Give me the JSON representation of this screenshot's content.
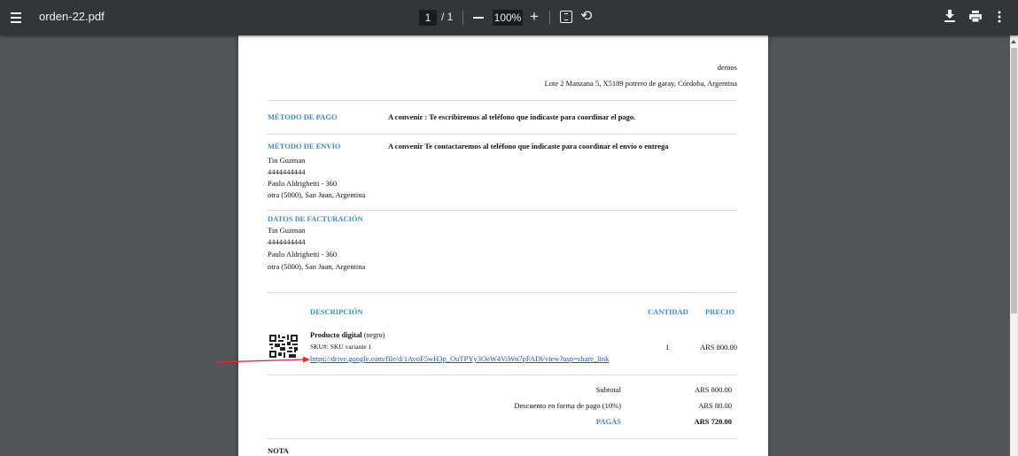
{
  "toolbar": {
    "file_name": "orden-22.pdf",
    "current_page": "1",
    "page_total": "/ 1",
    "zoom": "100%",
    "zoom_in_symbol": "+",
    "rotate_symbol": "⟲"
  },
  "icons": {
    "menu": "hamburger-menu-icon",
    "zoom_out": "minus-icon",
    "zoom_in": "plus-icon",
    "fit": "fit-page-icon",
    "rotate": "rotate-icon",
    "download": "download-icon",
    "print": "print-icon",
    "more": "more-vertical-icon"
  },
  "colors": {
    "toolbar_bg": "#323639",
    "viewer_bg": "#525659",
    "accent_blue": "#3a8ad4",
    "link": "#1a56c8",
    "arrow": "#e8262a"
  },
  "document": {
    "store_name": "demos",
    "store_address": "Lote 2 Manzana 5, X5189 potrero de garay, Córdoba, Argentina",
    "payment": {
      "label": "MÉTODO DE PAGO",
      "value": "A convenir : Te escribiremos al teléfono que indicaste para coordinar el pago."
    },
    "shipping": {
      "label": "MÉTODO DE ENVÍO",
      "value": "A convenir Te contactaremos al teléfono que indicaste para coordinar el envío o entrega",
      "lines": [
        "Tin Guzman",
        "4444444444",
        "Paulo Aldrighetti - 360",
        "otra (5000), San Juan, Argentina"
      ]
    },
    "billing": {
      "label": "DATOS DE FACTURACIÓN",
      "lines": [
        "Tin Guzman",
        "4444444444",
        "Paulo Aldrighetti - 360",
        "otra (5000), San Juan, Argentina"
      ]
    },
    "items_header": {
      "description": "DESCRIPCIÓN",
      "quantity": "CANTIDAD",
      "price": "PRECIO"
    },
    "item": {
      "name": "Producto digital",
      "variant": "(negro)",
      "sku": "SKU#: SKU variante 1",
      "link": "https://drive.google.com/file/d/1AvoF5wH3p_OuTPYy3OeW4ViWn7pFADi/view?usp=share_link",
      "quantity": "1",
      "price": "ARS 800.00"
    },
    "totals": {
      "subtotal_label": "Subtotal",
      "subtotal_value": "ARS 800.00",
      "discount_label": "Descuento en forma de pago (10%)",
      "discount_value": "ARS 80.00",
      "total_label": "PAGÁS",
      "total_value": "ARS 720.00"
    },
    "note_label": "NOTA"
  }
}
